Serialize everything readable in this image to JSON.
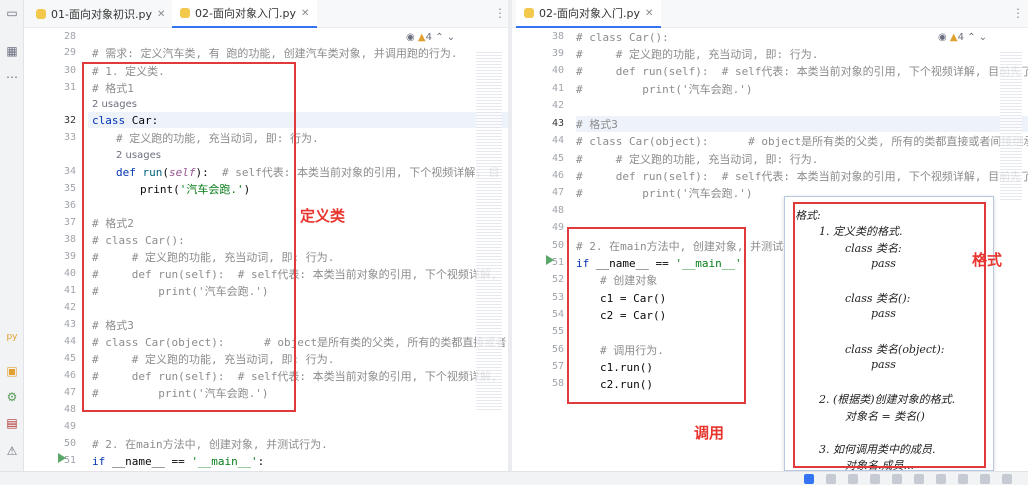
{
  "tabs": {
    "left": [
      {
        "label": "01-面向对象初识.py"
      },
      {
        "label": "02-面向对象入门.py"
      }
    ],
    "right": [
      {
        "label": "02-面向对象入门.py"
      }
    ]
  },
  "inspection": {
    "count": "4"
  },
  "left_editor": {
    "line_numbers": [
      "28",
      "29",
      "30",
      "31",
      "32",
      "33",
      "34",
      "35",
      "36",
      "37",
      "38",
      "39",
      "40",
      "41",
      "42",
      "43",
      "44",
      "45",
      "46",
      "47",
      "48",
      "49",
      "50",
      "51"
    ],
    "usages_1": "2 usages",
    "usages_2": "2 usages",
    "lines": {
      "l29": "# 需求: 定义汽车类, 有 跑的功能, 创建汽车类对象, 并调用跑的行为.",
      "l30": "# 1. 定义类.",
      "l31": "# 格式1",
      "l32_kw": "class ",
      "l32_name": "Car:",
      "l33": "# 定义跑的功能, 充当动词, 即: 行为.",
      "l34_kw": "def ",
      "l34_fn": "run",
      "l34_p1": "(",
      "l34_self": "self",
      "l34_p2": "):  ",
      "l34_cmt": "# self代表: 本类当前对象的引用, 下个视频详解, 目",
      "l35_pre": "print(",
      "l35_str": "'汽车会跑.'",
      "l35_post": ")",
      "l37": "# 格式2",
      "l38": "# class Car():",
      "l39": "#     # 定义跑的功能, 充当动词, 即: 行为.",
      "l40": "#     def run(self):  # self代表: 本类当前对象的引用, 下个视频详解,",
      "l41": "#         print('汽车会跑.')",
      "l43": "# 格式3",
      "l44": "# class Car(object):      # object是所有类的父类, 所有的类都直接或者",
      "l45": "#     # 定义跑的功能, 充当动词, 即: 行为.",
      "l46": "#     def run(self):  # self代表: 本类当前对象的引用, 下个视频详解,",
      "l47": "#         print('汽车会跑.')",
      "l50": "# 2. 在main方法中, 创建对象, 并测试行为.",
      "l51_kw": "if ",
      "l51_rest": "__name__ == ",
      "l51_str": "'__main__'",
      "l51_end": ":"
    }
  },
  "right_editor": {
    "line_numbers": [
      "38",
      "39",
      "40",
      "41",
      "42",
      "43",
      "44",
      "45",
      "46",
      "47",
      "48",
      "49",
      "50",
      "51",
      "52",
      "53",
      "54",
      "55",
      "56",
      "57",
      "58"
    ],
    "lines": {
      "r38": "# class Car():",
      "r39": "#     # 定义跑的功能, 充当动词, 即: 行为.",
      "r40": "#     def run(self):  # self代表: 本类当前对象的引用, 下个视频详解, 目前先了解",
      "r41": "#         print('汽车会跑.')",
      "r43": "# 格式3",
      "r44": "# class Car(object):      # object是所有类的父类, 所有的类都直接或者间接继承自",
      "r45": "#     # 定义跑的功能, 充当动词, 即: 行为.",
      "r46": "#     def run(self):  # self代表: 本类当前对象的引用, 下个视频详解, 目前先了解",
      "r47": "#         print('汽车会跑.')",
      "r50": "# 2. 在main方法中, 创建对象, 并测试行为.",
      "r51_kw": "if ",
      "r51_rest": "__name__ == ",
      "r51_str": "'__main__'",
      "r51_end": ":",
      "r52": "# 创建对象",
      "r53": "c1 = Car()",
      "r54": "c2 = Car()",
      "r56": "# 调用行为.",
      "r57": "c1.run()",
      "r58": "c2.run()"
    }
  },
  "annotations": {
    "define_class": "定义类",
    "call": "调用",
    "format": "格式"
  },
  "format_popup": {
    "lines": [
      "格式:",
      "1. 定义类的格式.",
      "class 类名:",
      "pass",
      "class 类名():",
      "pass",
      "class 类名(object):",
      "pass",
      "2. (根据类)创建对象的格式.",
      "对象名 = 类名()",
      "3. 如何调用类中的成员.",
      "对象名.成员..."
    ]
  },
  "colors": {
    "accent": "#3574f0",
    "annotation_red": "#e8352e",
    "comment": "#8c8c8c",
    "keyword": "#0033b3",
    "string": "#067d17"
  }
}
